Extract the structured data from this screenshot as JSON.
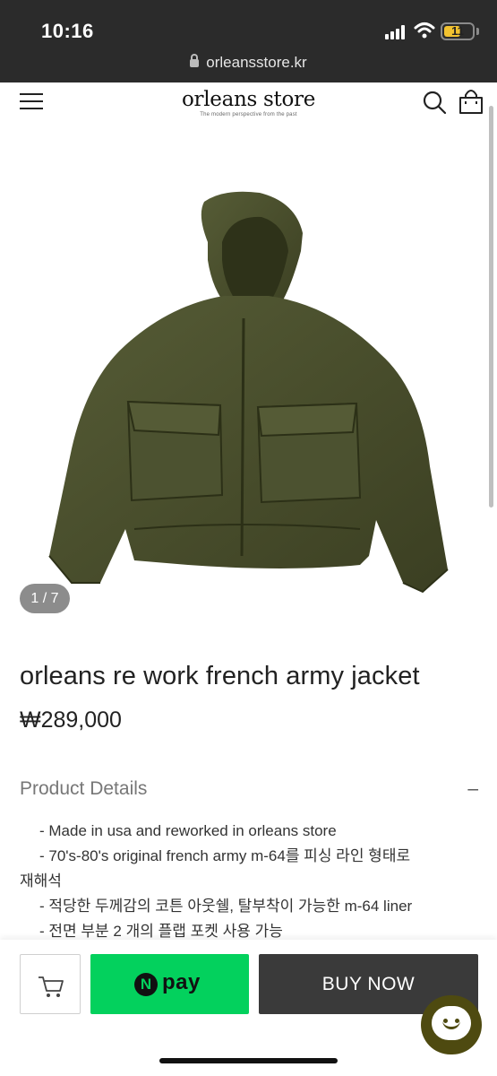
{
  "status_bar": {
    "time": "10:16",
    "battery": "11"
  },
  "browser": {
    "url": "orleansstore.kr"
  },
  "header": {
    "logo": "orleans store",
    "tagline": "The modern perspective from the past"
  },
  "gallery": {
    "counter": "1 / 7",
    "jacket_color": "#4a4f2c"
  },
  "product": {
    "title": "orleans re work french army jacket",
    "price": "₩289,000"
  },
  "details": {
    "title": "Product Details",
    "toggle": "–",
    "lines": [
      "- Made in usa and reworked in orleans store",
      "- 70's-80's  original french army m-64를 피싱 라인 형태로",
      "재해석",
      "- 적당한 두께감의 코튼 아웃쉘, 탈부착이 가능한  m-64 liner",
      "- 전면 부분 2 개의 플랩 포켓 사용 가능"
    ]
  },
  "actions": {
    "npay_label": "pay",
    "npay_n": "N",
    "buy_now": "BUY NOW",
    "npay_color": "#03d15d"
  }
}
